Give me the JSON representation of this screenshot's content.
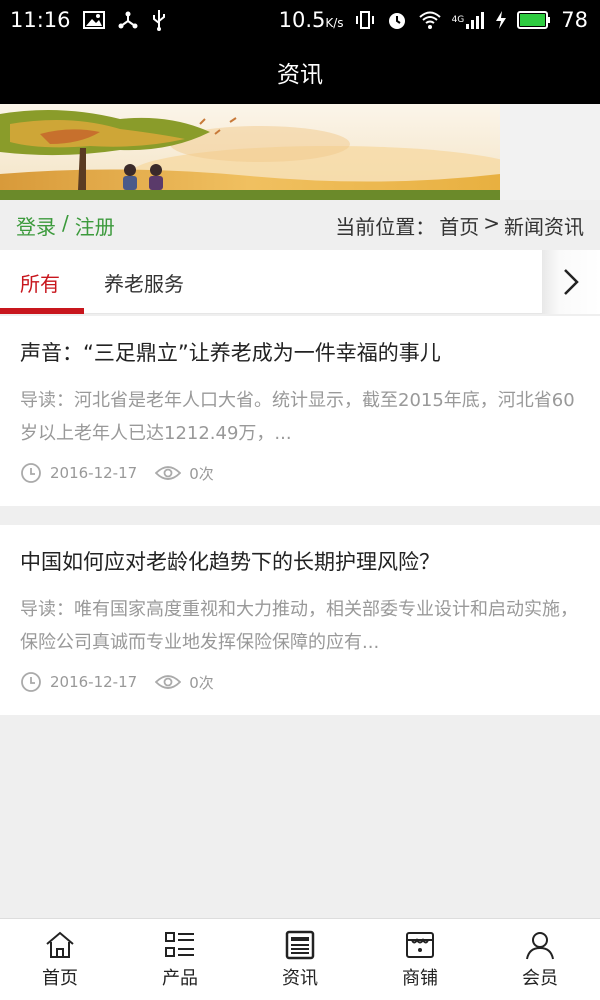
{
  "status": {
    "time": "11:16",
    "speed": "10.5",
    "speed_unit": "K/s",
    "network": "4G",
    "battery": "78"
  },
  "header": {
    "title": "资讯"
  },
  "crumbs": {
    "login": "登录",
    "separator": "/",
    "register": "注册",
    "location_label": "当前位置：",
    "home": "首页",
    "arrow": ">",
    "current": "新闻资讯"
  },
  "tabs": [
    {
      "label": "所有",
      "active": true
    },
    {
      "label": "养老服务",
      "active": false
    }
  ],
  "articles": [
    {
      "title": "声音：“三足鼎立”让养老成为一件幸福的事儿",
      "summary": "导读：河北省是老年人口大省。统计显示，截至2015年底，河北省60岁以上老年人已达1212.49万，...",
      "date": "2016-12-17",
      "views": "0次"
    },
    {
      "title": "中国如何应对老龄化趋势下的长期护理风险？",
      "summary": "导读：唯有国家高度重视和大力推动，相关部委专业设计和启动实施，保险公司真诚而专业地发挥保险保障的应有...",
      "date": "2016-12-17",
      "views": "0次"
    }
  ],
  "nav": [
    {
      "label": "首页",
      "icon": "home-icon"
    },
    {
      "label": "产品",
      "icon": "list-icon"
    },
    {
      "label": "资讯",
      "icon": "news-icon"
    },
    {
      "label": "商铺",
      "icon": "store-icon"
    },
    {
      "label": "会员",
      "icon": "user-icon"
    }
  ],
  "colors": {
    "accent": "#c8161d",
    "login_green": "#3c9a3c",
    "header_bg": "#000000",
    "page_bg": "#efefef"
  }
}
